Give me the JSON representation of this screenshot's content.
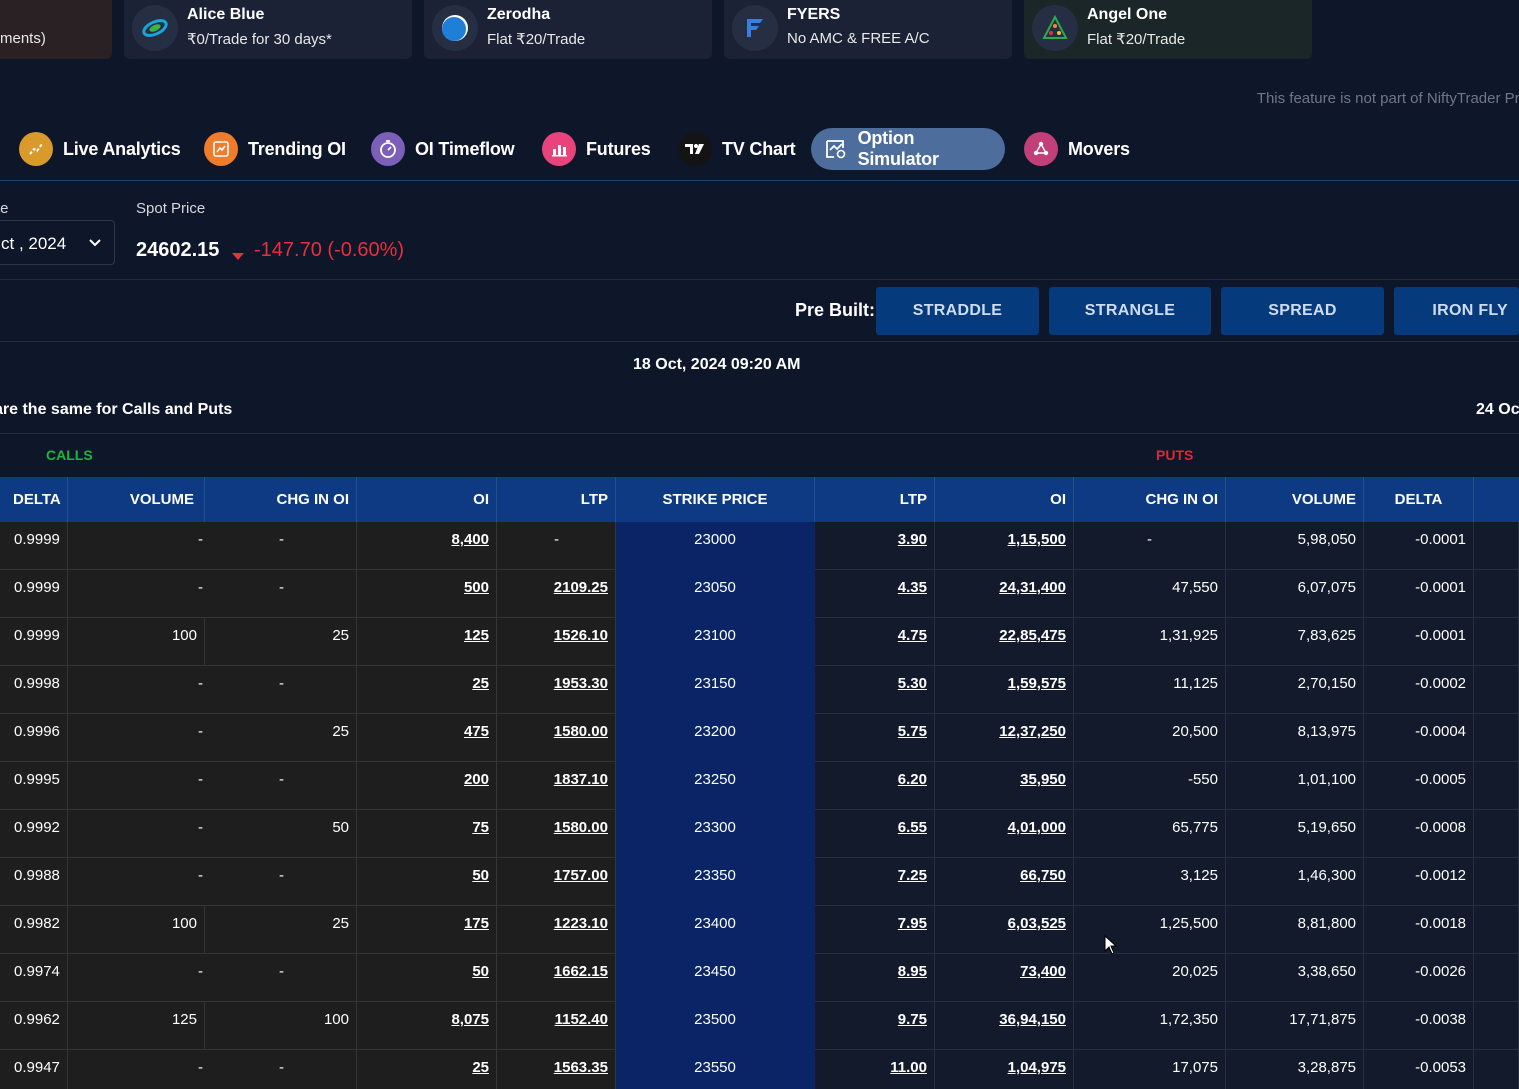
{
  "brokers": [
    {
      "name": "",
      "sub": "ments)"
    },
    {
      "name": "Alice Blue",
      "sub": "₹0/Trade for 30 days*"
    },
    {
      "name": "Zerodha",
      "sub": "Flat ₹20/Trade"
    },
    {
      "name": "FYERS",
      "sub": "No AMC & FREE A/C"
    },
    {
      "name": "Angel One",
      "sub": "Flat ₹20/Trade"
    }
  ],
  "notice": "This feature is not part of NiftyTrader Pri",
  "tabs": [
    {
      "label": "Live Analytics",
      "color": "#d89a2a"
    },
    {
      "label": "Trending OI",
      "color": "#ef7c2b"
    },
    {
      "label": "OI Timeflow",
      "color": "#7b5fb8"
    },
    {
      "label": "Futures",
      "color": "#e9437c"
    },
    {
      "label": "TV Chart",
      "color": "#1a1a1a"
    },
    {
      "label": "Option Simulator",
      "color": "#4d6d9c"
    },
    {
      "label": "Movers",
      "color": "#c2407a"
    }
  ],
  "expiry": {
    "label": "te",
    "value": "ct , 2024"
  },
  "spot": {
    "label": "Spot Price",
    "value": "24602.15",
    "change": "-147.70 (-0.60%)"
  },
  "prebuilt": {
    "label": "Pre Built:",
    "buttons": [
      "STRADDLE",
      "STRANGLE",
      "SPREAD",
      "IRON FLY"
    ]
  },
  "datetime": "18 Oct, 2024 09:20 AM",
  "info_left": "are the same for Calls and Puts",
  "info_right": "24 Oc",
  "calls_label": "CALLS",
  "puts_label": "PUTS",
  "columns": [
    "DELTA",
    "VOLUME",
    "CHG IN OI",
    "OI",
    "LTP",
    "STRIKE PRICE",
    "LTP",
    "OI",
    "CHG IN OI",
    "VOLUME",
    "DELTA"
  ],
  "rows": [
    {
      "c_delta": "0.9999",
      "c_vol": "-",
      "c_chg": "-",
      "c_oi": "8,400",
      "c_ltp": "-",
      "strike": "23000",
      "p_ltp": "3.90",
      "p_oi": "1,15,500",
      "p_chg": "-",
      "p_vol": "5,98,050",
      "p_delta": "-0.0001"
    },
    {
      "c_delta": "0.9999",
      "c_vol": "-",
      "c_chg": "-",
      "c_oi": "500",
      "c_ltp": "2109.25",
      "strike": "23050",
      "p_ltp": "4.35",
      "p_oi": "24,31,400",
      "p_chg": "47,550",
      "p_vol": "6,07,075",
      "p_delta": "-0.0001"
    },
    {
      "c_delta": "0.9999",
      "c_vol": "100",
      "c_chg": "25",
      "c_oi": "125",
      "c_ltp": "1526.10",
      "strike": "23100",
      "p_ltp": "4.75",
      "p_oi": "22,85,475",
      "p_chg": "1,31,925",
      "p_vol": "7,83,625",
      "p_delta": "-0.0001"
    },
    {
      "c_delta": "0.9998",
      "c_vol": "-",
      "c_chg": "-",
      "c_oi": "25",
      "c_ltp": "1953.30",
      "strike": "23150",
      "p_ltp": "5.30",
      "p_oi": "1,59,575",
      "p_chg": "11,125",
      "p_vol": "2,70,150",
      "p_delta": "-0.0002"
    },
    {
      "c_delta": "0.9996",
      "c_vol": "-",
      "c_chg": "25",
      "c_oi": "475",
      "c_ltp": "1580.00",
      "strike": "23200",
      "p_ltp": "5.75",
      "p_oi": "12,37,250",
      "p_chg": "20,500",
      "p_vol": "8,13,975",
      "p_delta": "-0.0004"
    },
    {
      "c_delta": "0.9995",
      "c_vol": "-",
      "c_chg": "-",
      "c_oi": "200",
      "c_ltp": "1837.10",
      "strike": "23250",
      "p_ltp": "6.20",
      "p_oi": "35,950",
      "p_chg": "-550",
      "p_vol": "1,01,100",
      "p_delta": "-0.0005"
    },
    {
      "c_delta": "0.9992",
      "c_vol": "-",
      "c_chg": "50",
      "c_oi": "75",
      "c_ltp": "1580.00",
      "strike": "23300",
      "p_ltp": "6.55",
      "p_oi": "4,01,000",
      "p_chg": "65,775",
      "p_vol": "5,19,650",
      "p_delta": "-0.0008"
    },
    {
      "c_delta": "0.9988",
      "c_vol": "-",
      "c_chg": "-",
      "c_oi": "50",
      "c_ltp": "1757.00",
      "strike": "23350",
      "p_ltp": "7.25",
      "p_oi": "66,750",
      "p_chg": "3,125",
      "p_vol": "1,46,300",
      "p_delta": "-0.0012"
    },
    {
      "c_delta": "0.9982",
      "c_vol": "100",
      "c_chg": "25",
      "c_oi": "175",
      "c_ltp": "1223.10",
      "strike": "23400",
      "p_ltp": "7.95",
      "p_oi": "6,03,525",
      "p_chg": "1,25,500",
      "p_vol": "8,81,800",
      "p_delta": "-0.0018"
    },
    {
      "c_delta": "0.9974",
      "c_vol": "-",
      "c_chg": "-",
      "c_oi": "50",
      "c_ltp": "1662.15",
      "strike": "23450",
      "p_ltp": "8.95",
      "p_oi": "73,400",
      "p_chg": "20,025",
      "p_vol": "3,38,650",
      "p_delta": "-0.0026"
    },
    {
      "c_delta": "0.9962",
      "c_vol": "125",
      "c_chg": "100",
      "c_oi": "8,075",
      "c_ltp": "1152.40",
      "strike": "23500",
      "p_ltp": "9.75",
      "p_oi": "36,94,150",
      "p_chg": "1,72,350",
      "p_vol": "17,71,875",
      "p_delta": "-0.0038"
    },
    {
      "c_delta": "0.9947",
      "c_vol": "-",
      "c_chg": "-",
      "c_oi": "25",
      "c_ltp": "1563.35",
      "strike": "23550",
      "p_ltp": "11.00",
      "p_oi": "1,04,975",
      "p_chg": "17,075",
      "p_vol": "3,28,875",
      "p_delta": "-0.0053"
    }
  ]
}
